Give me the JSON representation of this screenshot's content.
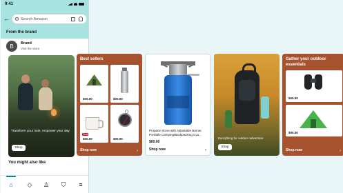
{
  "phone": {
    "status_time": "9:41",
    "search_placeholder": "Search Amazon",
    "section_title": "From the brand",
    "brand_name": "Brand",
    "brand_sub": "Visit the store",
    "brand_logo_letter": "B",
    "hero_text": "Transform your look, empower your day.",
    "hero_button": "Shop",
    "also_like": "You might also like",
    "tabs": [
      "home-icon",
      "spark-icon",
      "profile-icon",
      "cart-icon",
      "menu-icon"
    ]
  },
  "best_sellers": {
    "title": "Best sellers",
    "items": [
      {
        "price": "$00.00",
        "icon": "tent-icon"
      },
      {
        "price": "$00.00",
        "icon": "bottle-icon"
      },
      {
        "price": "$00.00",
        "icon": "mug-icon",
        "badge": "Deal"
      },
      {
        "price": "$00.00",
        "icon": "compass-icon"
      }
    ],
    "shop_now": "Shop now"
  },
  "product": {
    "name": "Propane Stove with Adjustable Burner, Portable Camping/Backpacking Coo...",
    "price": "$00.00",
    "shop_now": "Shop now"
  },
  "backpack": {
    "text": "Everything for outdoor adventure",
    "button": "Shop"
  },
  "essentials": {
    "title": "Gather your outdoor essentials",
    "items": [
      {
        "price": "$00.00",
        "icon": "binoculars-icon"
      },
      {
        "price": "$00.00",
        "icon": "tent-icon"
      }
    ],
    "shop_now": "Shop now"
  },
  "colors": {
    "background": "#e9f6f7",
    "header": "#a7e3e0",
    "card_rust": "#a7522f",
    "accent_teal": "#008296"
  }
}
